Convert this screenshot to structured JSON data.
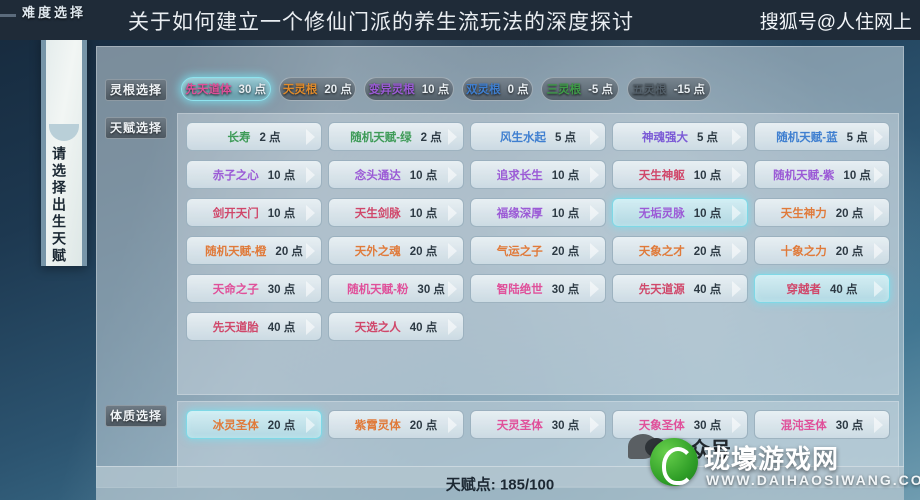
{
  "header": {
    "title": "关于如何建立一个修仙门派的养生流玩法的深度探讨",
    "watermark": "搜狐号@人住网上"
  },
  "difficulty_label": "难度选择",
  "scroll_banner": {
    "text": "请选择出生天赋"
  },
  "sections": {
    "root_tag": "灵根选择",
    "talent_tag": "天赋选择",
    "constitution_tag": "体质选择"
  },
  "root_tabs": [
    {
      "name": "先天道体",
      "cost": "30 点",
      "color": "#e0509a",
      "selected": true
    },
    {
      "name": "天灵根",
      "cost": "20 点",
      "color": "#e08a2a",
      "selected": false
    },
    {
      "name": "变异灵根",
      "cost": "10 点",
      "color": "#9b5ad6",
      "selected": false
    },
    {
      "name": "双灵根",
      "cost": "0 点",
      "color": "#3f7fd0",
      "selected": false
    },
    {
      "name": "三灵根",
      "cost": "-5 点",
      "color": "#3e9b48",
      "selected": false
    },
    {
      "name": "五灵根",
      "cost": "-15 点",
      "color": "#54606a",
      "selected": false
    }
  ],
  "talents": [
    {
      "name": "长寿",
      "cost": "2 点",
      "color": "#3e9b58",
      "selected": false
    },
    {
      "name": "随机天赋-绿",
      "cost": "2 点",
      "color": "#3e9b58",
      "selected": false
    },
    {
      "name": "风生水起",
      "cost": "5 点",
      "color": "#3f7fd0",
      "selected": false
    },
    {
      "name": "神魂强大",
      "cost": "5 点",
      "color": "#7b5ad6",
      "selected": false
    },
    {
      "name": "随机天赋-蓝",
      "cost": "5 点",
      "color": "#3f7fd0",
      "selected": false
    },
    {
      "name": "赤子之心",
      "cost": "10 点",
      "color": "#9b5ad6",
      "selected": false
    },
    {
      "name": "念头通达",
      "cost": "10 点",
      "color": "#9b5ad6",
      "selected": false
    },
    {
      "name": "追求长生",
      "cost": "10 点",
      "color": "#9b5ad6",
      "selected": false
    },
    {
      "name": "天生神躯",
      "cost": "10 点",
      "color": "#d0476a",
      "selected": false
    },
    {
      "name": "随机天赋-紫",
      "cost": "10 点",
      "color": "#9b5ad6",
      "selected": false
    },
    {
      "name": "剑开天门",
      "cost": "10 点",
      "color": "#d0476a",
      "selected": false
    },
    {
      "name": "天生剑脉",
      "cost": "10 点",
      "color": "#d0476a",
      "selected": false
    },
    {
      "name": "福缘深厚",
      "cost": "10 点",
      "color": "#9b5ad6",
      "selected": false
    },
    {
      "name": "无垢灵脉",
      "cost": "10 点",
      "color": "#9b5ad6",
      "selected": true
    },
    {
      "name": "天生神力",
      "cost": "20 点",
      "color": "#e07a3a",
      "selected": false
    },
    {
      "name": "随机天赋-橙",
      "cost": "20 点",
      "color": "#e07a3a",
      "selected": false
    },
    {
      "name": "天外之魂",
      "cost": "20 点",
      "color": "#e07a3a",
      "selected": false
    },
    {
      "name": "气运之子",
      "cost": "20 点",
      "color": "#e07a3a",
      "selected": false
    },
    {
      "name": "天象之才",
      "cost": "20 点",
      "color": "#e07a3a",
      "selected": false
    },
    {
      "name": "十象之力",
      "cost": "20 点",
      "color": "#e07a3a",
      "selected": false
    },
    {
      "name": "天命之子",
      "cost": "30 点",
      "color": "#e0509a",
      "selected": false
    },
    {
      "name": "随机天赋-粉",
      "cost": "30 点",
      "color": "#e0509a",
      "selected": false
    },
    {
      "name": "智陆绝世",
      "cost": "30 点",
      "color": "#e0509a",
      "selected": false
    },
    {
      "name": "先天道源",
      "cost": "40 点",
      "color": "#d0476a",
      "selected": false
    },
    {
      "name": "穿越者",
      "cost": "40 点",
      "color": "#d0476a",
      "selected": true
    },
    {
      "name": "先天道胎",
      "cost": "40 点",
      "color": "#d0476a",
      "selected": false
    },
    {
      "name": "天选之人",
      "cost": "40 点",
      "color": "#d0476a",
      "selected": false
    }
  ],
  "constitutions": [
    {
      "name": "冰灵圣体",
      "cost": "20 点",
      "color": "#e07a3a",
      "selected": true
    },
    {
      "name": "紫霄灵体",
      "cost": "20 点",
      "color": "#e07a3a",
      "selected": false
    },
    {
      "name": "天灵圣体",
      "cost": "30 点",
      "color": "#e0509a",
      "selected": false
    },
    {
      "name": "天象圣体",
      "cost": "30 点",
      "color": "#e0509a",
      "selected": false
    },
    {
      "name": "混沌圣体",
      "cost": "30 点",
      "color": "#e0509a",
      "selected": false
    }
  ],
  "status": {
    "talent_points": "天赋点: 185/100"
  },
  "wechat_overlay": {
    "label": "公众号",
    "icon": "wechat-icon"
  },
  "site_logo": {
    "name": "珑壕游戏网",
    "url": "WWW.DAIHAOSIWANG.COM",
    "icon": "leaf-logo-icon"
  }
}
